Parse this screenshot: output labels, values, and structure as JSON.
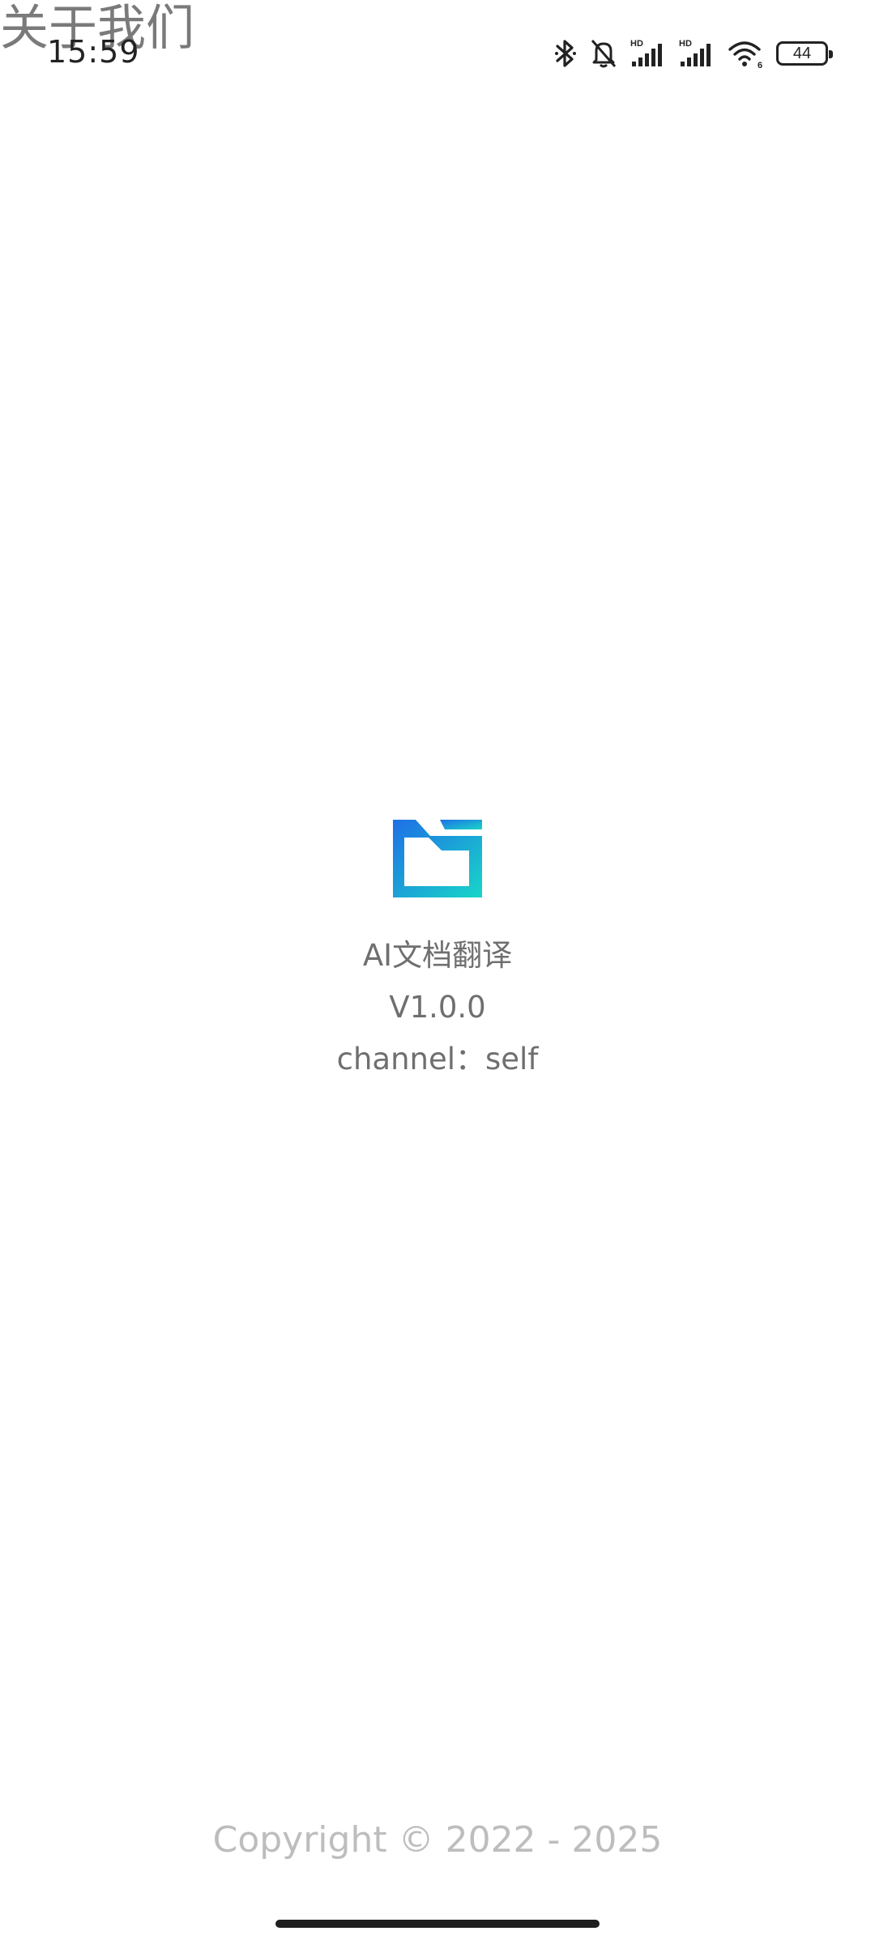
{
  "header": {
    "title": "关于我们"
  },
  "status_bar": {
    "time": "15:59",
    "battery_level": "44",
    "icons": [
      "bluetooth-icon",
      "mute-bell-icon",
      "hd-signal-icon",
      "hd-signal-icon",
      "wifi-icon",
      "battery-icon"
    ],
    "hd_label": "HD",
    "wifi_badge": "6"
  },
  "app_info": {
    "logo_icon": "folder-logo-icon",
    "name": "AI文档翻译",
    "version": "V1.0.0",
    "channel": "channel：self"
  },
  "footer": {
    "copyright": "Copyright © 2022 - 2025"
  },
  "colors": {
    "logo_gradient_start": "#1e6fe6",
    "logo_gradient_end": "#18d6c8",
    "text_gray": "#6f6f6f",
    "copyright_gray": "#bdbdbd"
  }
}
